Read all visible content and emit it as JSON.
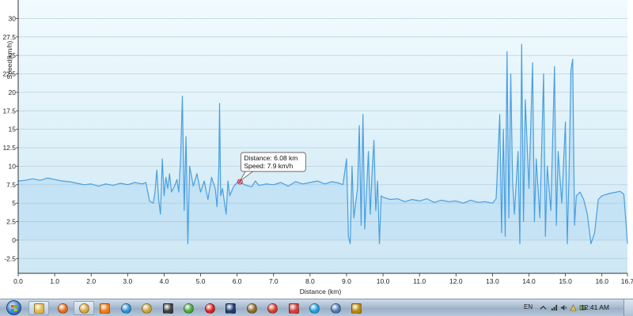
{
  "chart_data": {
    "type": "line",
    "xlabel": "Distance (km)",
    "ylabel": "Speed(km/h)",
    "xlim": [
      0.0,
      16.7
    ],
    "ylim": [
      -4.5,
      32.5
    ],
    "x_ticks": [
      "0.0",
      "1.0",
      "2.0",
      "3.0",
      "4.0",
      "5.0",
      "6.0",
      "7.0",
      "8.0",
      "9.0",
      "10.0",
      "11.0",
      "12.0",
      "13.0",
      "14.0",
      "15.0",
      "16.0",
      "16.7"
    ],
    "y_ticks": [
      "-2.5",
      "0",
      "2.5",
      "5",
      "7.5",
      "10",
      "12.5",
      "15",
      "17.5",
      "20",
      "22.5",
      "25",
      "27.5",
      "30"
    ],
    "grid": true,
    "series": [
      {
        "points": [
          [
            0.0,
            8.0
          ],
          [
            0.2,
            8.1
          ],
          [
            0.4,
            8.3
          ],
          [
            0.6,
            8.1
          ],
          [
            0.8,
            8.4
          ],
          [
            1.0,
            8.2
          ],
          [
            1.2,
            8.0
          ],
          [
            1.4,
            7.9
          ],
          [
            1.6,
            7.7
          ],
          [
            1.8,
            7.5
          ],
          [
            2.0,
            7.6
          ],
          [
            2.2,
            7.3
          ],
          [
            2.4,
            7.6
          ],
          [
            2.6,
            7.4
          ],
          [
            2.8,
            7.7
          ],
          [
            3.0,
            7.5
          ],
          [
            3.2,
            7.8
          ],
          [
            3.4,
            7.6
          ],
          [
            3.5,
            7.8
          ],
          [
            3.6,
            5.3
          ],
          [
            3.7,
            5.0
          ],
          [
            3.75,
            6.5
          ],
          [
            3.8,
            9.5
          ],
          [
            3.85,
            5.5
          ],
          [
            3.9,
            3.5
          ],
          [
            3.95,
            11.0
          ],
          [
            4.0,
            6.0
          ],
          [
            4.05,
            8.5
          ],
          [
            4.1,
            7.0
          ],
          [
            4.15,
            9.0
          ],
          [
            4.2,
            6.5
          ],
          [
            4.3,
            7.5
          ],
          [
            4.35,
            8.2
          ],
          [
            4.4,
            6.5
          ],
          [
            4.45,
            11.0
          ],
          [
            4.5,
            19.5
          ],
          [
            4.55,
            4.0
          ],
          [
            4.6,
            14.0
          ],
          [
            4.65,
            -0.5
          ],
          [
            4.7,
            10.0
          ],
          [
            4.8,
            7.3
          ],
          [
            4.9,
            9.0
          ],
          [
            5.0,
            6.5
          ],
          [
            5.1,
            8.0
          ],
          [
            5.2,
            5.5
          ],
          [
            5.3,
            8.5
          ],
          [
            5.4,
            7.0
          ],
          [
            5.45,
            4.5
          ],
          [
            5.5,
            10.0
          ],
          [
            5.52,
            18.5
          ],
          [
            5.55,
            6.0
          ],
          [
            5.6,
            7.0
          ],
          [
            5.7,
            3.5
          ],
          [
            5.75,
            8.0
          ],
          [
            5.8,
            6.0
          ],
          [
            5.9,
            7.2
          ],
          [
            6.0,
            7.8
          ],
          [
            6.08,
            7.9
          ],
          [
            6.2,
            7.5
          ],
          [
            6.4,
            7.2
          ],
          [
            6.5,
            8.0
          ],
          [
            6.6,
            7.4
          ],
          [
            6.8,
            7.6
          ],
          [
            7.0,
            7.5
          ],
          [
            7.2,
            7.8
          ],
          [
            7.4,
            7.3
          ],
          [
            7.6,
            7.9
          ],
          [
            7.8,
            7.6
          ],
          [
            8.0,
            7.8
          ],
          [
            8.2,
            8.0
          ],
          [
            8.4,
            7.6
          ],
          [
            8.6,
            7.9
          ],
          [
            8.8,
            7.7
          ],
          [
            8.9,
            7.5
          ],
          [
            9.0,
            11.0
          ],
          [
            9.05,
            0.5
          ],
          [
            9.1,
            -0.5
          ],
          [
            9.15,
            10.0
          ],
          [
            9.2,
            3.0
          ],
          [
            9.3,
            7.0
          ],
          [
            9.35,
            15.5
          ],
          [
            9.4,
            2.0
          ],
          [
            9.45,
            17.0
          ],
          [
            9.5,
            1.5
          ],
          [
            9.6,
            12.0
          ],
          [
            9.65,
            3.5
          ],
          [
            9.7,
            9.0
          ],
          [
            9.75,
            13.5
          ],
          [
            9.8,
            4.0
          ],
          [
            9.85,
            8.0
          ],
          [
            9.9,
            -0.5
          ],
          [
            9.95,
            6.0
          ],
          [
            10.0,
            5.8
          ],
          [
            10.2,
            5.5
          ],
          [
            10.4,
            5.6
          ],
          [
            10.6,
            5.2
          ],
          [
            10.8,
            5.5
          ],
          [
            11.0,
            5.3
          ],
          [
            11.2,
            5.6
          ],
          [
            11.4,
            5.1
          ],
          [
            11.6,
            5.4
          ],
          [
            11.8,
            5.2
          ],
          [
            12.0,
            5.3
          ],
          [
            12.2,
            5.0
          ],
          [
            12.4,
            5.4
          ],
          [
            12.6,
            5.1
          ],
          [
            12.8,
            5.2
          ],
          [
            13.0,
            5.0
          ],
          [
            13.1,
            5.6
          ],
          [
            13.2,
            17.0
          ],
          [
            13.25,
            1.0
          ],
          [
            13.3,
            15.0
          ],
          [
            13.35,
            0.5
          ],
          [
            13.4,
            25.5
          ],
          [
            13.45,
            3.0
          ],
          [
            13.5,
            22.5
          ],
          [
            13.55,
            8.0
          ],
          [
            13.6,
            3.5
          ],
          [
            13.7,
            12.0
          ],
          [
            13.75,
            -0.5
          ],
          [
            13.8,
            26.5
          ],
          [
            13.85,
            2.5
          ],
          [
            13.9,
            19.0
          ],
          [
            14.0,
            7.0
          ],
          [
            14.1,
            24.0
          ],
          [
            14.15,
            2.5
          ],
          [
            14.2,
            11.0
          ],
          [
            14.3,
            3.0
          ],
          [
            14.4,
            22.5
          ],
          [
            14.45,
            0.5
          ],
          [
            14.5,
            10.0
          ],
          [
            14.6,
            4.0
          ],
          [
            14.7,
            23.5
          ],
          [
            14.75,
            2.0
          ],
          [
            14.8,
            12.0
          ],
          [
            14.9,
            5.0
          ],
          [
            15.0,
            16.0
          ],
          [
            15.05,
            -0.5
          ],
          [
            15.1,
            9.0
          ],
          [
            15.15,
            23.0
          ],
          [
            15.2,
            24.5
          ],
          [
            15.25,
            2.0
          ],
          [
            15.3,
            6.0
          ],
          [
            15.4,
            6.5
          ],
          [
            15.5,
            5.5
          ],
          [
            15.6,
            3.5
          ],
          [
            15.7,
            -0.5
          ],
          [
            15.8,
            1.0
          ],
          [
            15.9,
            5.5
          ],
          [
            16.0,
            6.0
          ],
          [
            16.2,
            6.3
          ],
          [
            16.4,
            6.5
          ],
          [
            16.5,
            6.6
          ],
          [
            16.6,
            6.2
          ],
          [
            16.65,
            3.0
          ],
          [
            16.7,
            -0.5
          ]
        ]
      }
    ],
    "tooltip": {
      "x": 6.08,
      "y": 7.9,
      "line1": "Distance: 6.08 km",
      "line2": "Speed: 7.9 km/h"
    }
  },
  "taskbar": {
    "apps": [
      {
        "name": "windows-explorer-icon",
        "color": "#e0b84a"
      },
      {
        "name": "firefox-icon",
        "color": "#e66a1e"
      },
      {
        "name": "file-manager-icon",
        "color": "#d9a63a"
      },
      {
        "name": "media-player-icon",
        "color": "#f07a10"
      },
      {
        "name": "ie-icon",
        "color": "#2b8fd6"
      },
      {
        "name": "tool-icon",
        "color": "#c9a23a"
      },
      {
        "name": "monitor-icon",
        "color": "#3c3c3c"
      },
      {
        "name": "leaf-app-icon",
        "color": "#49a53a"
      },
      {
        "name": "pdf-icon",
        "color": "#d62020"
      },
      {
        "name": "photoshop-icon",
        "color": "#1f3b6e"
      },
      {
        "name": "usb-icon",
        "color": "#8a6a2a"
      },
      {
        "name": "record-icon",
        "color": "#d23a2a"
      },
      {
        "name": "paint-icon",
        "color": "#d23a3a"
      },
      {
        "name": "skype-icon",
        "color": "#1d9ee0"
      },
      {
        "name": "window-icon",
        "color": "#4a78b0"
      },
      {
        "name": "game-icon",
        "color": "#b8860b"
      }
    ],
    "lang": "EN",
    "clock": "12:41 AM"
  }
}
